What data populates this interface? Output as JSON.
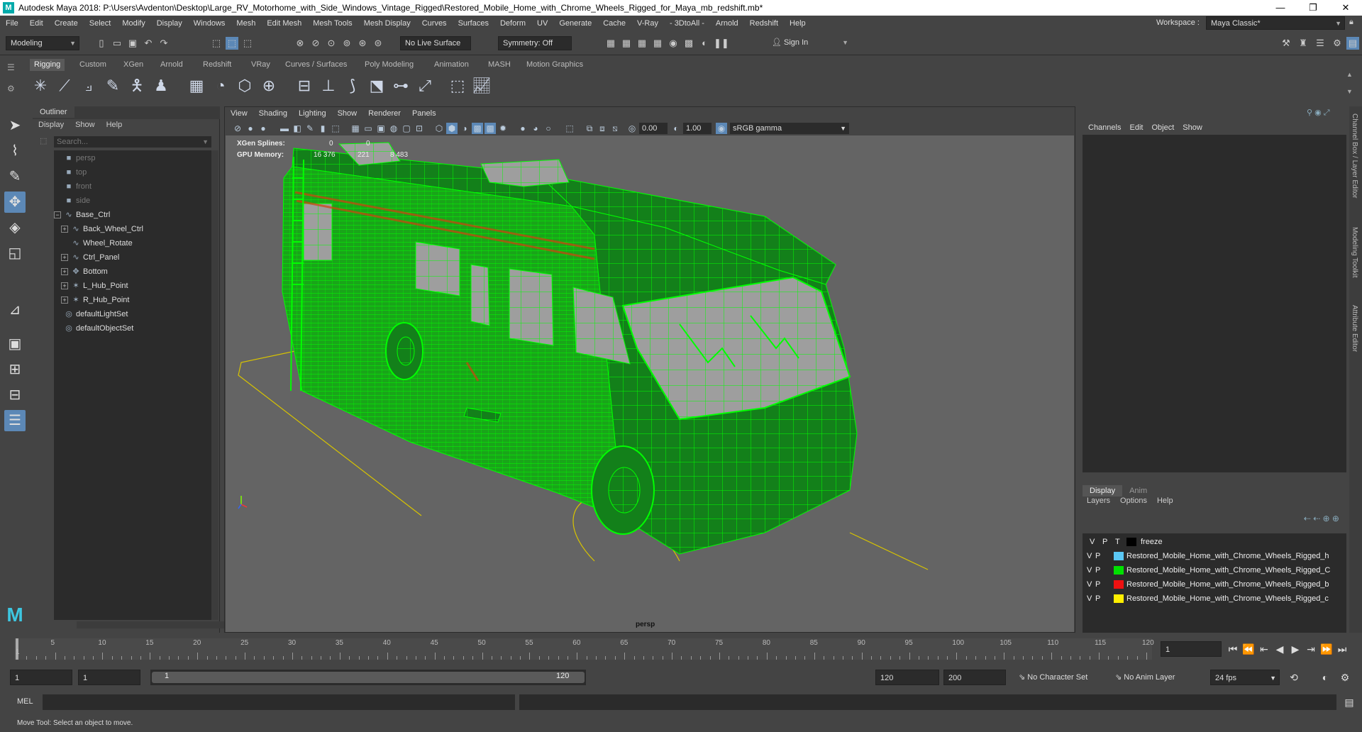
{
  "title": "Autodesk Maya 2018: P:\\Users\\Avdenton\\Desktop\\Large_RV_Motorhome_with_Side_Windows_Vintage_Rigged\\Restored_Mobile_Home_with_Chrome_Wheels_Rigged_for_Maya_mb_redshift.mb*",
  "window_controls": [
    "—",
    "❐",
    "✕"
  ],
  "menus": [
    "File",
    "Edit",
    "Create",
    "Select",
    "Modify",
    "Display",
    "Windows",
    "Mesh",
    "Edit Mesh",
    "Mesh Tools",
    "Mesh Display",
    "Curves",
    "Surfaces",
    "Deform",
    "UV",
    "Generate",
    "Cache",
    "V-Ray",
    "- 3DtoAll -",
    "Arnold",
    "Redshift",
    "Help"
  ],
  "workspace": {
    "label": "Workspace :",
    "value": "Maya Classic*"
  },
  "status": {
    "mode": "Modeling",
    "live_surface": "No Live Surface",
    "symmetry": "Symmetry: Off",
    "sign_in": "Sign In"
  },
  "shelf_tabs": [
    "Rigging",
    "Custom",
    "XGen",
    "Arnold",
    "Redshift",
    "VRay",
    "Curves / Surfaces",
    "Poly Modeling",
    "Animation",
    "MASH",
    "Motion Graphics"
  ],
  "shelf_active": "Rigging",
  "outliner": {
    "title": "Outliner",
    "menu": [
      "Display",
      "Show",
      "Help"
    ],
    "search_placeholder": "Search...",
    "items": [
      {
        "label": "persp",
        "dim": true,
        "indent": 0,
        "icon": "camera-icon",
        "glyph": "■"
      },
      {
        "label": "top",
        "dim": true,
        "indent": 0,
        "icon": "camera-icon",
        "glyph": "■"
      },
      {
        "label": "front",
        "dim": true,
        "indent": 0,
        "icon": "camera-icon",
        "glyph": "■"
      },
      {
        "label": "side",
        "dim": true,
        "indent": 0,
        "icon": "camera-icon",
        "glyph": "■"
      },
      {
        "label": "Base_Ctrl",
        "dim": false,
        "indent": 0,
        "expand": "−",
        "icon": "curve-icon",
        "glyph": "∿"
      },
      {
        "label": "Back_Wheel_Ctrl",
        "dim": false,
        "indent": 1,
        "expand": "+",
        "icon": "curve-icon",
        "glyph": "∿"
      },
      {
        "label": "Wheel_Rotate",
        "dim": false,
        "indent": 1,
        "icon": "curve-icon",
        "glyph": "∿"
      },
      {
        "label": "Ctrl_Panel",
        "dim": false,
        "indent": 1,
        "expand": "+",
        "icon": "curve-icon",
        "glyph": "∿"
      },
      {
        "label": "Bottom",
        "dim": false,
        "indent": 1,
        "expand": "+",
        "icon": "group-icon",
        "glyph": "✥"
      },
      {
        "label": "L_Hub_Point",
        "dim": false,
        "indent": 1,
        "expand": "+",
        "icon": "locator-icon",
        "glyph": "✶"
      },
      {
        "label": "R_Hub_Point",
        "dim": false,
        "indent": 1,
        "expand": "+",
        "icon": "locator-icon",
        "glyph": "✶"
      },
      {
        "label": "defaultLightSet",
        "dim": false,
        "indent": 0,
        "icon": "set-icon",
        "glyph": "◎"
      },
      {
        "label": "defaultObjectSet",
        "dim": false,
        "indent": 0,
        "icon": "set-icon",
        "glyph": "◎"
      }
    ]
  },
  "viewport": {
    "menu": [
      "View",
      "Shading",
      "Lighting",
      "Show",
      "Renderer",
      "Panels"
    ],
    "near": "0.00",
    "far": "1.00",
    "color_space": "sRGB gamma",
    "camera_label": "persp",
    "hud": {
      "xgen_label": "XGen Splines:",
      "xgen_a": "0",
      "xgen_b": "0",
      "gpu_label": "GPU Memory:",
      "gpu_a": "16 376",
      "gpu_b": "221",
      "gpu_c": "8 483"
    },
    "wire_color": "#00ff00"
  },
  "channel_box": {
    "menu": [
      "Channels",
      "Edit",
      "Object",
      "Show"
    ]
  },
  "layers": {
    "tabs": [
      "Display",
      "Anim"
    ],
    "menu": [
      "Layers",
      "Options",
      "Help"
    ],
    "header": {
      "v": "V",
      "p": "P",
      "t": "T",
      "name": "freeze"
    },
    "rows": [
      {
        "v": "V",
        "p": "P",
        "color": "#5bc8f5",
        "name": "Restored_Mobile_Home_with_Chrome_Wheels_Rigged_h"
      },
      {
        "v": "V",
        "p": "P",
        "color": "#00e000",
        "name": "Restored_Mobile_Home_with_Chrome_Wheels_Rigged_C"
      },
      {
        "v": "V",
        "p": "P",
        "color": "#ee1111",
        "name": "Restored_Mobile_Home_with_Chrome_Wheels_Rigged_b"
      },
      {
        "v": "V",
        "p": "P",
        "color": "#ffee00",
        "name": "Restored_Mobile_Home_with_Chrome_Wheels_Rigged_c"
      }
    ]
  },
  "side_tabs": [
    "Channel Box / Layer Editor",
    "Modeling Toolkit",
    "Attribute Editor"
  ],
  "timeline": {
    "ticks": [
      "5",
      "10",
      "15",
      "20",
      "25",
      "30",
      "35",
      "40",
      "45",
      "50",
      "55",
      "60",
      "65",
      "70",
      "75",
      "80",
      "85",
      "90",
      "95",
      "100",
      "105",
      "110",
      "115",
      "120"
    ],
    "start_tick": "1",
    "current_frame": "1"
  },
  "range": {
    "start": "1",
    "playback_start": "1",
    "range_start": "1",
    "range_end": "120",
    "playback_end": "120",
    "end": "200",
    "character_set": "No Character Set",
    "anim_layer": "No Anim Layer",
    "fps": "24 fps"
  },
  "command": {
    "label": "MEL"
  },
  "help_text": "Move Tool: Select an object to move."
}
